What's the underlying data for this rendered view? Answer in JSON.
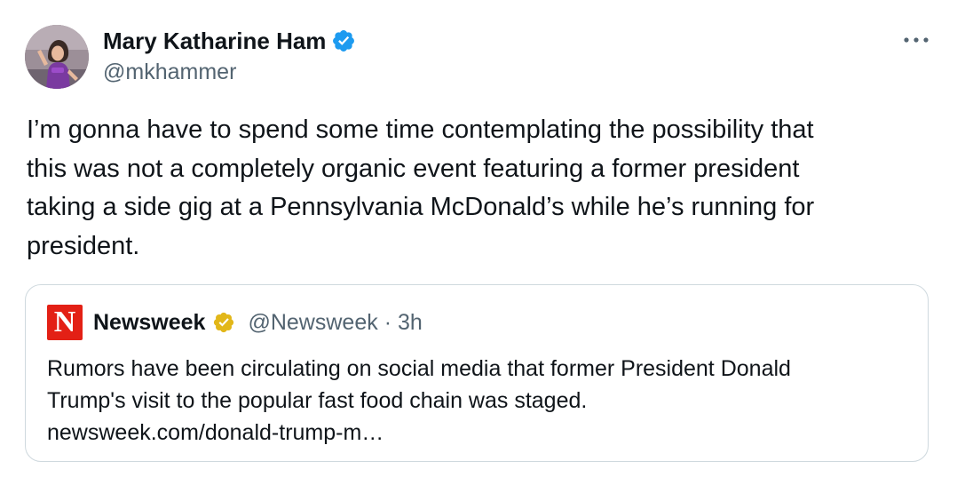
{
  "author": {
    "name": "Mary Katharine Ham",
    "handle": "@mkhammer",
    "avatar_icon": "profile-photo",
    "verified_icon": "verified-blue-check-icon",
    "verified_color": "#1d9bf0"
  },
  "menu": {
    "more_icon": "more-horizontal-icon"
  },
  "tweet": {
    "text": "I’m gonna have to spend some time contemplating the possibility that\nthis was not a completely organic event featuring a former president\ntaking a side gig at a Pennsylvania McDonald’s while he’s running for\npresident."
  },
  "quote": {
    "logo_letter": "N",
    "logo_color": "#e32015",
    "name": "Newsweek",
    "verified_icon": "verified-gold-check-icon",
    "verified_color": "#e2b719",
    "handle": "@Newsweek",
    "separator": "·",
    "time": "3h",
    "text": "Rumors have been circulating on social media that former President Donald\nTrump's visit to the popular fast food chain was staged.\nnewsweek.com/donald-trump-m…"
  }
}
